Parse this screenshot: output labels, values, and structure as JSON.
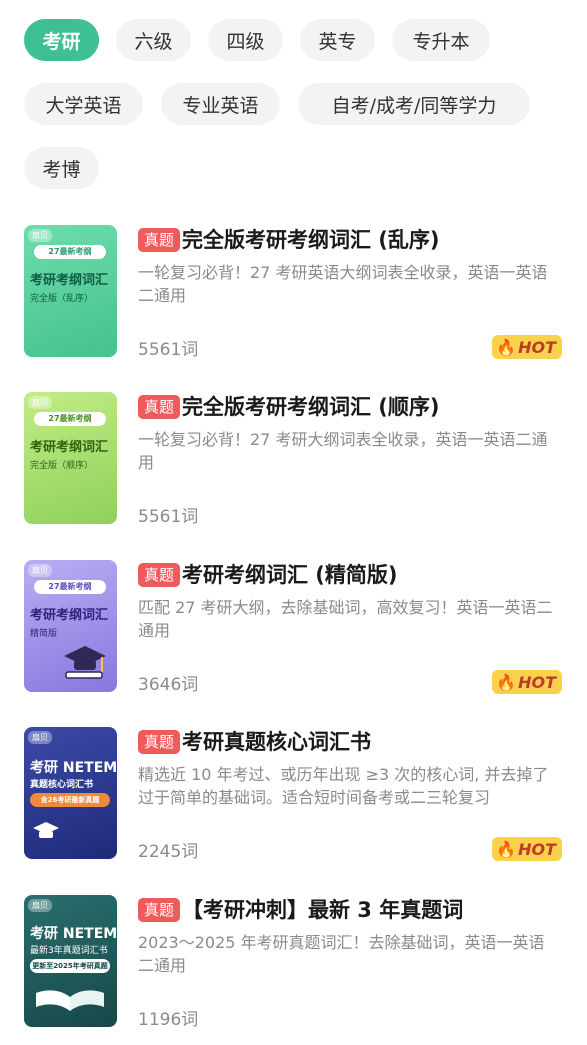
{
  "filters": [
    {
      "label": "考研",
      "active": true
    },
    {
      "label": "六级",
      "active": false
    },
    {
      "label": "四级",
      "active": false
    },
    {
      "label": "英专",
      "active": false
    },
    {
      "label": "专升本",
      "active": false
    },
    {
      "label": "大学英语",
      "active": false
    },
    {
      "label": "专业英语",
      "active": false
    },
    {
      "label": "自考/成考/同等学力",
      "active": false
    },
    {
      "label": "考博",
      "active": false
    }
  ],
  "books": [
    {
      "tag": "真题",
      "title": "完全版考研考纲词汇 (乱序)",
      "desc": "一轮复习必背！27 考研英语大纲词表全收录，英语一英语二通用",
      "count": "5561词",
      "hot": "HOT",
      "cover": {
        "brand": "扇贝",
        "pill": "27最新考纲",
        "title": "考研考纲词汇",
        "sub": "完全版（乱序）",
        "color": "#5fd0a0"
      }
    },
    {
      "tag": "真题",
      "title": "完全版考研考纲词汇 (顺序)",
      "desc": "一轮复习必背！27 考研大纲词表全收录，英语一英语二通用",
      "count": "5561词",
      "hot": "",
      "cover": {
        "brand": "扇贝",
        "pill": "27最新考纲",
        "title": "考研考纲词汇",
        "sub": "完全版（顺序）",
        "color": "#a8df6a"
      }
    },
    {
      "tag": "真题",
      "title": "考研考纲词汇 (精简版)",
      "desc": "匹配 27 考研大纲，去除基础词，高效复习！英语一英语二通用",
      "count": "3646词",
      "hot": "HOT",
      "cover": {
        "brand": "扇贝",
        "pill": "27最新考纲",
        "title": "考研考纲词汇",
        "sub": "精简版",
        "color": "#9a8ee8"
      }
    },
    {
      "tag": "真题",
      "title": "考研真题核心词汇书",
      "desc": "精选近 10 年考过、或历年出现 ≥3 次的核心词, 并去掉了过于简单的基础词。适合短时间备考或二三轮复习",
      "count": "2245词",
      "hot": "HOT",
      "cover": {
        "brand": "扇贝",
        "pill": "含26考研最新真题",
        "title": "考研 NETEM",
        "sub": "真题核心词汇书",
        "color": "#2c3a8c"
      }
    },
    {
      "tag": "真题",
      "title": "【考研冲刺】最新 3 年真题词",
      "desc": "2023～2025 年考研真题词汇！去除基础词，英语一英语二通用",
      "count": "1196词",
      "hot": "",
      "cover": {
        "brand": "扇贝",
        "pill": "更新至2025年考研真题",
        "title": "考研 NETEM",
        "sub": "最新3年真题词汇书",
        "color": "#1f5a5a"
      }
    }
  ]
}
